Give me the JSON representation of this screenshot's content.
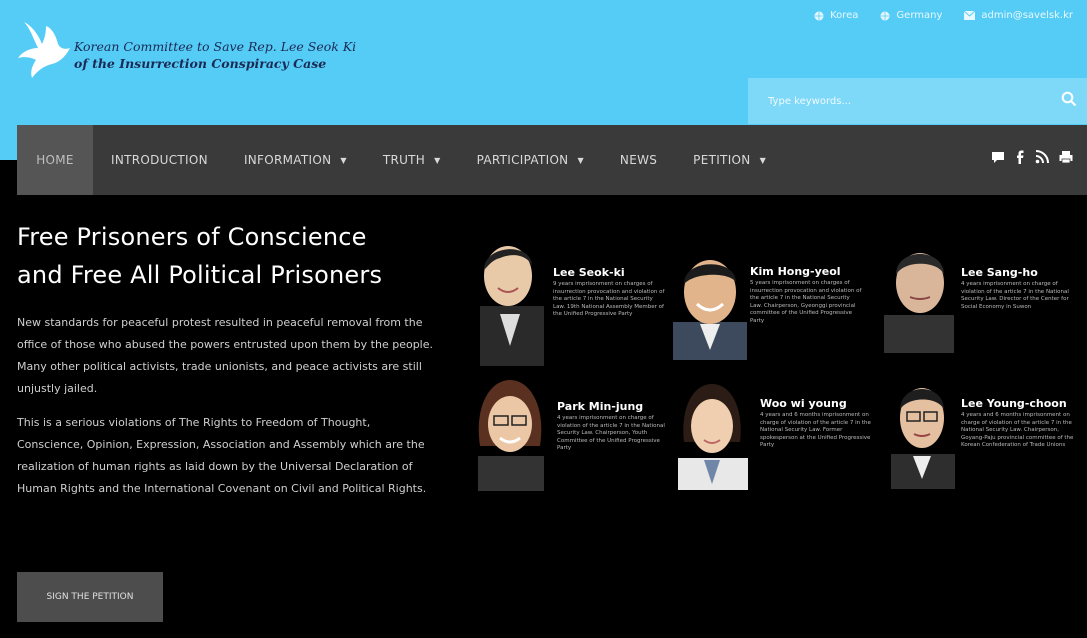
{
  "header": {
    "org_line1": "Korean Committee to Save Rep. Lee Seok Ki",
    "org_line2": "of the Insurrection Conspiracy Case",
    "toplinks": [
      "Korea",
      "Germany",
      "admin@savelsk.kr"
    ]
  },
  "search": {
    "placeholder": "Type keywords..."
  },
  "nav": {
    "items": [
      {
        "label": "HOME",
        "dropdown": false
      },
      {
        "label": "INTRODUCTION",
        "dropdown": false
      },
      {
        "label": "INFORMATION",
        "dropdown": true
      },
      {
        "label": "TRUTH",
        "dropdown": true
      },
      {
        "label": "PARTICIPATION",
        "dropdown": true
      },
      {
        "label": "NEWS",
        "dropdown": false
      },
      {
        "label": "PETITION",
        "dropdown": true
      }
    ],
    "social": [
      "chat-icon",
      "facebook-icon",
      "rss-icon",
      "print-icon"
    ]
  },
  "hero": {
    "title_line1": "Free Prisoners of Conscience",
    "title_line2": "and Free All Political Prisoners",
    "p1": "New standards for peaceful protest resulted in peaceful removal from the office of those who abused the powers entrusted upon them by the people.",
    "p2": "Many other political activists, trade unionists, and peace activists are still unjustly jailed.",
    "p3": "This is a serious violations of The Rights to Freedom of Thought, Conscience, Opinion, Expression, Association and Assembly which are the realization of human rights as laid down by the Universal Declaration of Human Rights and the International Covenant on Civil and Political Rights.",
    "button": "SIGN THE PETITION"
  },
  "prisoners": [
    {
      "name": "Lee Seok-ki",
      "desc": "9 years imprisonment on charges of insurrection provocation and violation of the article 7 in the National Security Law. 19th National Assembly Member of the Unified Progressive Party"
    },
    {
      "name": "Kim Hong-yeol",
      "desc": "5 years imprisonment on charges of insurrection provocation and violation of the article 7 in the National Security Law. Chairperson, Gyeonggi provincial committee of the Unified Progressive Party"
    },
    {
      "name": "Lee Sang-ho",
      "desc": "4 years imprisonment on charge of violation of the article 7 in the National Security Law. Director of the Center for Social Economy in Suwon"
    },
    {
      "name": "Park Min-jung",
      "desc": "4 years imprisonment on charge of violation of the article 7 in the National Security Law. Chairperson, Youth Committee of the Unified Progressive Party"
    },
    {
      "name": "Woo wi young",
      "desc": "4 years and 6 months imprisonment on charge of violation of the article 7 in the National Security Law. Former spokesperson at the Unified Progressive Party"
    },
    {
      "name": "Lee Young-choon",
      "desc": "4 years and 6 months imprisonment on charge of violation of the article 7 in the National Security Law. Chairperson, Goyang-Paju provincial committee of the Korean Confederation of Trade Unions"
    }
  ],
  "colors": {
    "top_band": "#55ccf6",
    "search_box": "#7ed8f8",
    "nav": "#3a3a3a",
    "nav_active": "#555555",
    "page": "#000000",
    "button": "#4d4d4d"
  }
}
